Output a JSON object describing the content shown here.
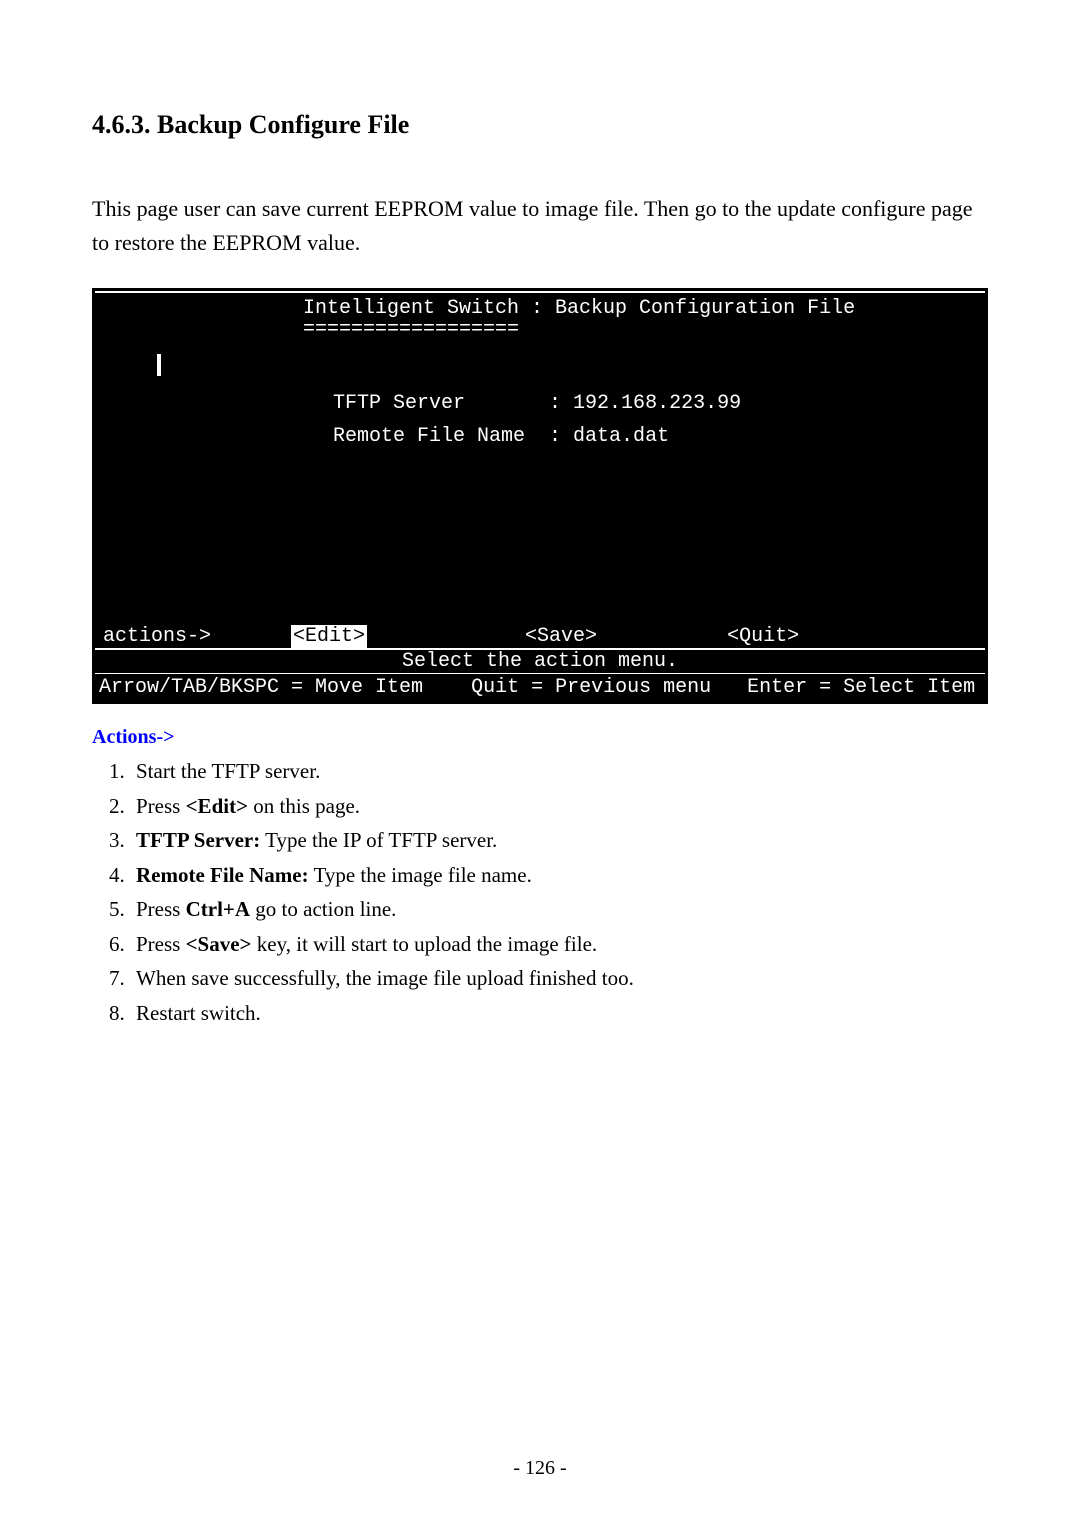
{
  "heading": "4.6.3. Backup Configure File",
  "intro": "This page user can save current EEPROM value to image file. Then go to the update configure page to restore the EEPROM value.",
  "terminal": {
    "title": "Intelligent Switch : Backup Configuration File",
    "underline": "==================",
    "tftp_label": "TFTP Server",
    "tftp_value": ": 192.168.223.99",
    "remote_label": "Remote File Name",
    "remote_value": ": data.dat",
    "actions_label": "actions->",
    "edit": "<Edit>",
    "save": "<Save>",
    "quit": "<Quit>",
    "hint": "Select the action menu.",
    "help_move": "Arrow/TAB/BKSPC = Move Item",
    "help_quit": "Quit = Previous menu",
    "help_enter": "Enter = Select Item"
  },
  "actions_heading": "Actions->",
  "steps": {
    "s1": "Start the TFTP server.",
    "s2_a": "Press ",
    "s2_b": "<Edit>",
    "s2_c": " on this page.",
    "s3_a": "TFTP Server:",
    "s3_b": " Type the IP of TFTP server.",
    "s4_a": "Remote File Name:",
    "s4_b": " Type the image file name.",
    "s5_a": "Press ",
    "s5_b": "Ctrl+A",
    "s5_c": " go to action line.",
    "s6_a": "Press ",
    "s6_b": "<Save>",
    "s6_c": " key, it will start to upload the image file.",
    "s7": "When save successfully, the image file upload finished too.",
    "s8": "Restart switch."
  },
  "page_number": "- 126 -"
}
